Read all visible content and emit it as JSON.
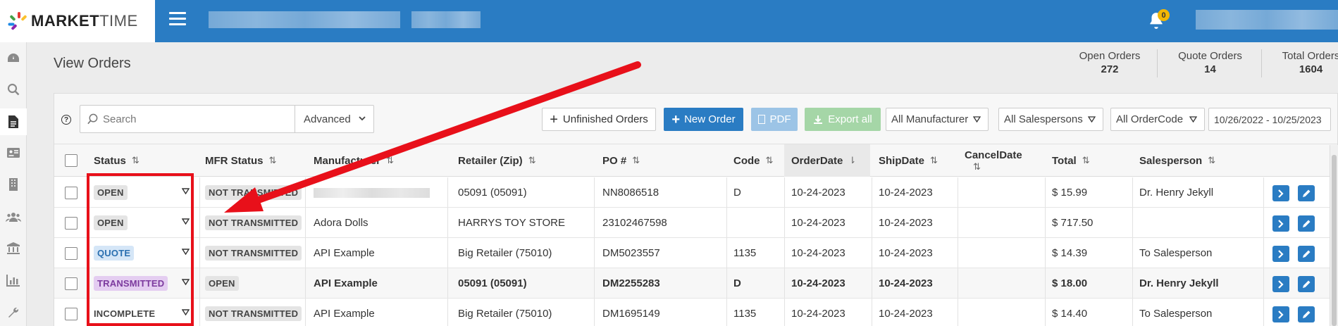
{
  "app": {
    "logo_bold": "MARKET",
    "logo_light": "TIME"
  },
  "header": {
    "notifications_count": "0"
  },
  "page": {
    "title": "View Orders"
  },
  "stats": [
    {
      "label": "Open Orders",
      "value": "272"
    },
    {
      "label": "Quote Orders",
      "value": "14"
    },
    {
      "label": "Total Orders",
      "value": "1604"
    }
  ],
  "toolbar": {
    "search_placeholder": "Search",
    "advanced_label": "Advanced",
    "unfinished_label": "Unfinished Orders",
    "new_order_label": "New Order",
    "pdf_label": "PDF",
    "export_label": "Export all",
    "manufacturer_filter": "All Manufacturer",
    "salesperson_filter": "All Salespersons",
    "ordercode_filter": "All OrderCode",
    "date_range": "10/26/2022 - 10/25/2023"
  },
  "table": {
    "columns": [
      "Status",
      "MFR Status",
      "Manufacturer",
      "Retailer (Zip)",
      "PO #",
      "Code",
      "OrderDate",
      "ShipDate",
      "CancelDate",
      "Total",
      "Salesperson"
    ],
    "rows": [
      {
        "status": "OPEN",
        "mfr_status": "NOT TRANSMITTED",
        "manufacturer": "",
        "retailer": "05091 (05091)",
        "po": "NN8086518",
        "code": "D",
        "order_date": "10-24-2023",
        "ship_date": "10-24-2023",
        "cancel_date": "",
        "total": "$ 15.99",
        "salesperson": "Dr. Henry Jekyll"
      },
      {
        "status": "OPEN",
        "mfr_status": "NOT TRANSMITTED",
        "manufacturer": "Adora Dolls",
        "retailer": "HARRYS TOY STORE",
        "po": "23102467598",
        "code": "",
        "order_date": "10-24-2023",
        "ship_date": "10-24-2023",
        "cancel_date": "",
        "total": "$ 717.50",
        "salesperson": ""
      },
      {
        "status": "QUOTE",
        "mfr_status": "NOT TRANSMITTED",
        "manufacturer": "API Example",
        "retailer": "Big Retailer (75010)",
        "po": "DM5023557",
        "code": "1135",
        "order_date": "10-24-2023",
        "ship_date": "10-24-2023",
        "cancel_date": "",
        "total": "$ 14.39",
        "salesperson": "To Salesperson"
      },
      {
        "status": "TRANSMITTED",
        "mfr_status": "OPEN",
        "manufacturer": "API Example",
        "retailer": "05091 (05091)",
        "po": "DM2255283",
        "code": "D",
        "order_date": "10-24-2023",
        "ship_date": "10-24-2023",
        "cancel_date": "",
        "total": "$ 18.00",
        "salesperson": "Dr. Henry Jekyll"
      },
      {
        "status": "INCOMPLETE",
        "mfr_status": "NOT TRANSMITTED",
        "manufacturer": "API Example",
        "retailer": "Big Retailer (75010)",
        "po": "DM1695149",
        "code": "1135",
        "order_date": "10-24-2023",
        "ship_date": "10-24-2023",
        "cancel_date": "",
        "total": "$ 14.40",
        "salesperson": "To Salesperson"
      }
    ]
  },
  "icons": {
    "menu": "hamburger-icon",
    "bell": "bell-icon",
    "search": "search-icon",
    "help": "question-circle-icon",
    "view": "chevron-right-icon",
    "edit": "pencil-icon"
  },
  "colors": {
    "brand": "#2a7cc3",
    "annotation": "#e8101a",
    "quote_badge": "#d5e6f7",
    "transmitted_badge": "#e4cdf1",
    "export": "#a5d6a7"
  }
}
